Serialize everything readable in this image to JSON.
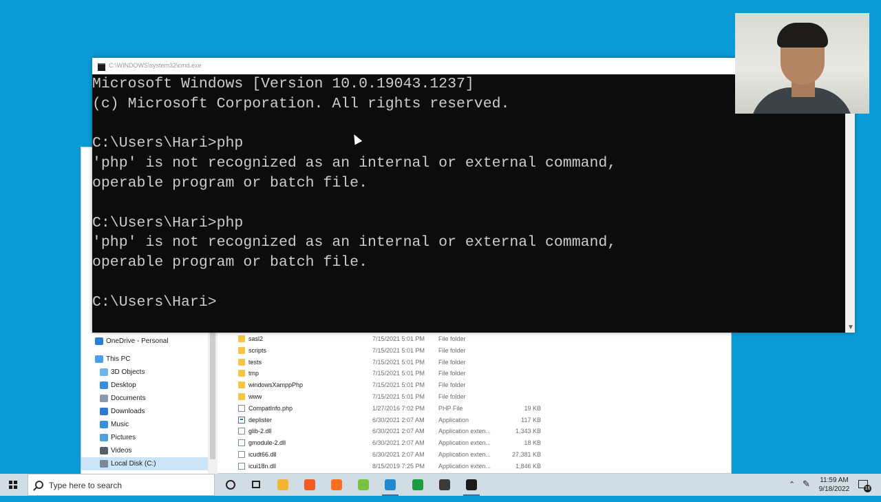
{
  "cmd": {
    "title": "C:\\WINDOWS\\system32\\cmd.exe",
    "lines": [
      "Microsoft Windows [Version 10.0.19043.1237]",
      "(c) Microsoft Corporation. All rights reserved.",
      "",
      "C:\\Users\\Hari>php",
      "'php' is not recognized as an internal or external command,",
      "operable program or batch file.",
      "",
      "C:\\Users\\Hari>php",
      "'php' is not recognized as an internal or external command,",
      "operable program or batch file.",
      "",
      "C:\\Users\\Hari>"
    ]
  },
  "explorer": {
    "nav": [
      {
        "label": "OneDrive - Personal",
        "icon": "onedrive-icon",
        "color": "#2b7cd3"
      },
      {
        "label": "This PC",
        "icon": "pc-icon",
        "color": "#4aa0e6"
      },
      {
        "label": "3D Objects",
        "icon": "cube-icon",
        "color": "#6bb6e8"
      },
      {
        "label": "Desktop",
        "icon": "desktop-icon",
        "color": "#3a8ee0"
      },
      {
        "label": "Documents",
        "icon": "documents-icon",
        "color": "#8a9bb0"
      },
      {
        "label": "Downloads",
        "icon": "download-icon",
        "color": "#2f7bd0"
      },
      {
        "label": "Music",
        "icon": "music-icon",
        "color": "#3a8ee0"
      },
      {
        "label": "Pictures",
        "icon": "pictures-icon",
        "color": "#4fa0de"
      },
      {
        "label": "Videos",
        "icon": "videos-icon",
        "color": "#585f6a"
      },
      {
        "label": "Local Disk (C:)",
        "icon": "drive-icon",
        "color": "#7a8899"
      }
    ],
    "files": [
      {
        "name": "sasl2",
        "date": "7/15/2021 5:01 PM",
        "type": "File folder",
        "size": "",
        "kind": "folder"
      },
      {
        "name": "scripts",
        "date": "7/15/2021 5:01 PM",
        "type": "File folder",
        "size": "",
        "kind": "folder"
      },
      {
        "name": "tests",
        "date": "7/15/2021 5:01 PM",
        "type": "File folder",
        "size": "",
        "kind": "folder"
      },
      {
        "name": "tmp",
        "date": "7/15/2021 5:01 PM",
        "type": "File folder",
        "size": "",
        "kind": "folder"
      },
      {
        "name": "windowsXamppPhp",
        "date": "7/15/2021 5:01 PM",
        "type": "File folder",
        "size": "",
        "kind": "folder"
      },
      {
        "name": "www",
        "date": "7/15/2021 5:01 PM",
        "type": "File folder",
        "size": "",
        "kind": "folder"
      },
      {
        "name": "CompatInfo.php",
        "date": "1/27/2016 7:02 PM",
        "type": "PHP File",
        "size": "19 KB",
        "kind": "doc"
      },
      {
        "name": "deplister",
        "date": "6/30/2021 2:07 AM",
        "type": "Application",
        "size": "117 KB",
        "kind": "app"
      },
      {
        "name": "glib-2.dll",
        "date": "6/30/2021 2:07 AM",
        "type": "Application exten...",
        "size": "1,343 KB",
        "kind": "doc"
      },
      {
        "name": "gmodule-2.dll",
        "date": "6/30/2021 2:07 AM",
        "type": "Application exten...",
        "size": "18 KB",
        "kind": "doc"
      },
      {
        "name": "icudt66.dll",
        "date": "6/30/2021 2:07 AM",
        "type": "Application exten...",
        "size": "27,381 KB",
        "kind": "doc"
      },
      {
        "name": "icui18n.dll",
        "date": "8/15/2019 7:25 PM",
        "type": "Application exten...",
        "size": "1,846 KB",
        "kind": "doc"
      }
    ]
  },
  "taskbar": {
    "search_placeholder": "Type here to search",
    "apps": [
      {
        "name": "file-explorer-icon",
        "color": "#f2b632",
        "active": false
      },
      {
        "name": "brave-browser-icon",
        "color": "#f05a24",
        "active": false
      },
      {
        "name": "sublime-text-icon",
        "color": "#ff6d1f",
        "active": false
      },
      {
        "name": "notepadpp-icon",
        "color": "#7cc242",
        "active": false
      },
      {
        "name": "vscode-icon",
        "color": "#1f8ad2",
        "active": true
      },
      {
        "name": "hs-app-icon",
        "color": "#1e9b3f",
        "active": false
      },
      {
        "name": "obs-studio-icon",
        "color": "#3a3a3a",
        "active": false
      },
      {
        "name": "cmd-icon",
        "color": "#1b1b1b",
        "active": true
      }
    ],
    "time": "11:59 AM",
    "date": "9/18/2022",
    "notification_count": "16"
  }
}
